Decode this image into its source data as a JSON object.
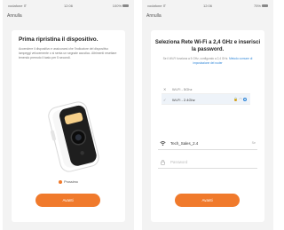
{
  "left_screen": {
    "status": {
      "carrier": "vodafone IT",
      "time": "12:06",
      "battery": "100%"
    },
    "back_label": "Annulla",
    "title": "Prima ripristina il dispositivo.",
    "paragraph": "Accendere il dispositivo e assicurarsi che l'indicatore del dispositivo lampeggi velocemente o si senta un segnale acustico. Altrimenti resettare tenendo premuto il tasto per 5 secondi.",
    "radio_label": "Prossimo",
    "next_button": "Avanti",
    "colors": {
      "accent": "#f07a2c",
      "camera_body": "#ffffff",
      "camera_face": "#1e1e1e"
    }
  },
  "right_screen": {
    "status": {
      "carrier": "vodafone IT",
      "time": "12:06",
      "battery": "75%"
    },
    "back_label": "Annulla",
    "title": "Seleziona Rete Wi-Fi a 2,4 GHz e inserisci la password.",
    "subtitle": "Se il Wi-Fi funziona a 5 GHz, configuralo a 2,4 GHz.",
    "subtitle_link": "Metodo comune di impostazione del router",
    "wifi_list": [
      {
        "prefix": "✕",
        "name": "Wi-Fi - 5Ghz",
        "icons": "",
        "selected": false
      },
      {
        "prefix": "✓",
        "name": "Wi-Fi - 2.4Ghz",
        "icons": "🔒 ◠",
        "selected": true
      }
    ],
    "ssid_value": "Tech_Sales_2.4",
    "ssid_change": "Se",
    "password_placeholder": "Password",
    "next_button": "Avanti",
    "colors": {
      "accent": "#f07a2c",
      "link": "#2f86d8"
    }
  }
}
